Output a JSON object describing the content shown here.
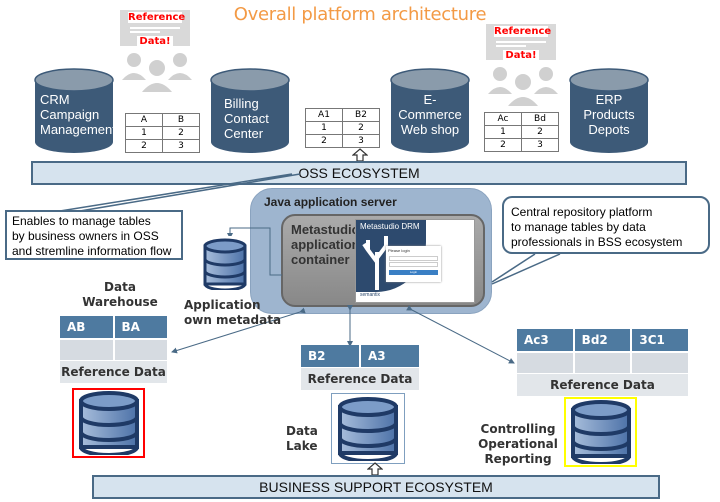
{
  "title": "Overall platform architecture",
  "reference_bubble": {
    "line1": "Reference",
    "line2": "Data!"
  },
  "top_systems": [
    {
      "id": "crm",
      "label": "CRM Campaign Management",
      "lines": [
        "CRM",
        "Campaign",
        "Management"
      ]
    },
    {
      "id": "billing",
      "label": "Billing Contact Center",
      "lines": [
        "Billing",
        "Contact",
        "Center"
      ]
    },
    {
      "id": "ecommerce",
      "label": "E-Commerce Web shop",
      "lines": [
        "E-",
        "Commerce",
        "Web shop"
      ]
    },
    {
      "id": "erp",
      "label": "ERP Products Depots",
      "lines": [
        "ERP",
        "Products",
        "Depots"
      ]
    }
  ],
  "top_tables": [
    {
      "rows": [
        [
          "A",
          "B"
        ],
        [
          "1",
          "2"
        ],
        [
          "2",
          "3"
        ]
      ]
    },
    {
      "rows": [
        [
          "A1",
          "B2"
        ],
        [
          "1",
          "2"
        ],
        [
          "2",
          "3"
        ]
      ]
    },
    {
      "rows": [
        [
          "Ac",
          "Bd"
        ],
        [
          "1",
          "2"
        ],
        [
          "2",
          "3"
        ]
      ]
    }
  ],
  "oss_bar": "OSS ECOSYSTEM",
  "bss_bar": "BUSINESS SUPPORT ECOSYSTEM",
  "callout_left": [
    "Enables to manage tables",
    "by business owners in OSS",
    "and stremline information flow"
  ],
  "callout_right": [
    "Central repository platform",
    "to manage tables by data",
    "professionals in BSS ecosystem"
  ],
  "java_server": "Java application server",
  "metastudio": [
    "Metastudio",
    "application",
    "container"
  ],
  "drm_screen": {
    "title": "Metastudio DRM",
    "login_title": "Please login",
    "login_button": "Login",
    "footer": "semantix"
  },
  "app_metadata": [
    "Application",
    "own metadata"
  ],
  "warehouse": {
    "label": [
      "Data",
      "Warehouse"
    ],
    "headers": [
      "AB",
      "BA"
    ],
    "footer": "Reference Data",
    "highlight": "#ff0000"
  },
  "datalake": {
    "label": [
      "Data",
      "Lake"
    ],
    "headers": [
      "B2",
      "A3"
    ],
    "footer": "Reference Data",
    "highlight": "#7f9fbf"
  },
  "controlling": {
    "label": [
      "Controlling",
      "Operational",
      "Reporting"
    ],
    "headers": [
      "Ac3",
      "Bd2",
      "3C1"
    ],
    "footer": "Reference Data",
    "highlight": "#ffff00"
  },
  "colors": {
    "title": "#f39a45",
    "cylinder": "#3d5a78",
    "cylinder_top": "#8a9bab",
    "eco_bar": "#d6e3ee",
    "table_header": "#4e7aa0",
    "reference_text": "#ff0000"
  }
}
